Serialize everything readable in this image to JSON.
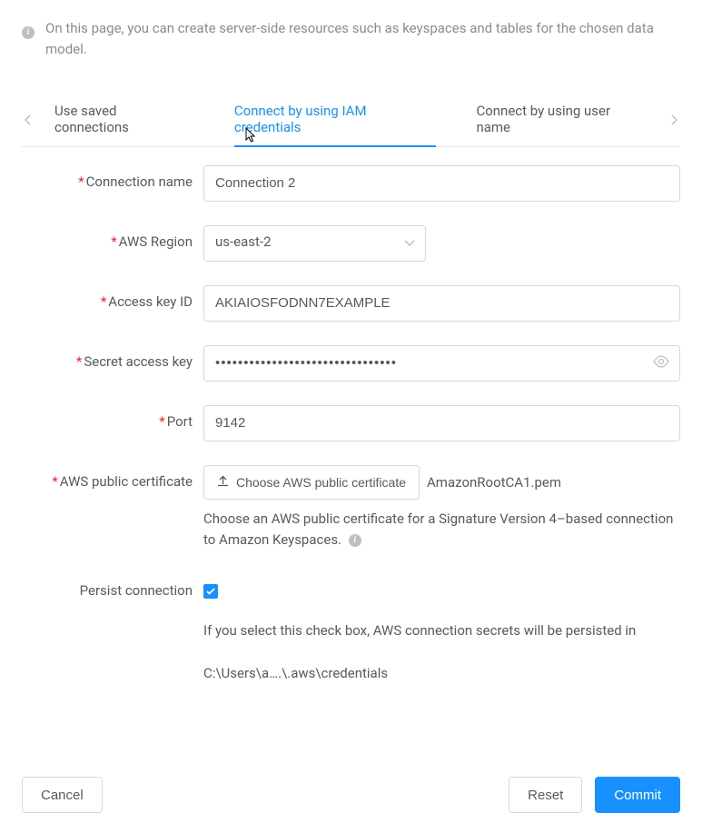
{
  "info": {
    "text": "On this page, you can create server-side resources such as keyspaces and tables for the chosen data model."
  },
  "tabs": {
    "items": [
      {
        "label": "Use saved connections"
      },
      {
        "label": "Connect by using IAM credentials"
      },
      {
        "label": "Connect by using user name"
      }
    ]
  },
  "form": {
    "connection_name": {
      "label": "Connection name",
      "value": "Connection 2"
    },
    "aws_region": {
      "label": "AWS Region",
      "value": "us-east-2"
    },
    "access_key_id": {
      "label": "Access key ID",
      "value": "AKIAIOSFODNN7EXAMPLE"
    },
    "secret_access_key": {
      "label": "Secret access key",
      "value": "••••••••••••••••••••••••••••••••"
    },
    "port": {
      "label": "Port",
      "value": "9142"
    },
    "aws_public_certificate": {
      "label": "AWS public certificate",
      "button": "Choose AWS public certificate",
      "filename": "AmazonRootCA1.pem",
      "helper": "Choose an AWS public certificate for a Signature Version 4–based connection to Amazon Keyspaces."
    },
    "persist_connection": {
      "label": "Persist connection",
      "checked": true,
      "helper": "If you select this check box, AWS connection secrets will be persisted in",
      "path": "C:\\Users\\a….\\.aws\\credentials"
    }
  },
  "footer": {
    "cancel": "Cancel",
    "reset": "Reset",
    "commit": "Commit"
  }
}
